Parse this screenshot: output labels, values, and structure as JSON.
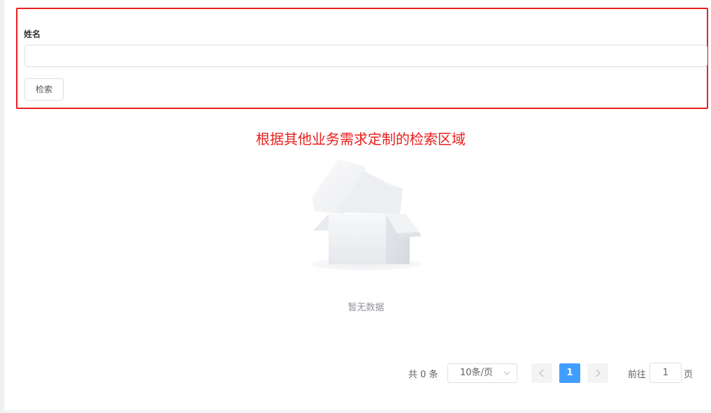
{
  "search_form": {
    "name_label": "姓名",
    "name_value": "",
    "search_button_label": "检索"
  },
  "annotation_text": "根据其他业务需求定制的检索区域",
  "empty_state": {
    "icon": "empty-box-icon",
    "text": "暂无数据"
  },
  "pagination": {
    "total_text": "共 0 条",
    "page_size_label": "10条/页",
    "prev_icon": "chevron-left-icon",
    "next_icon": "chevron-right-icon",
    "current_page": "1",
    "goto_prefix": "前往",
    "goto_value": "1",
    "goto_suffix": "页"
  },
  "colors": {
    "highlight_border": "#e8201f",
    "primary": "#409eff",
    "muted_text": "#909399"
  }
}
